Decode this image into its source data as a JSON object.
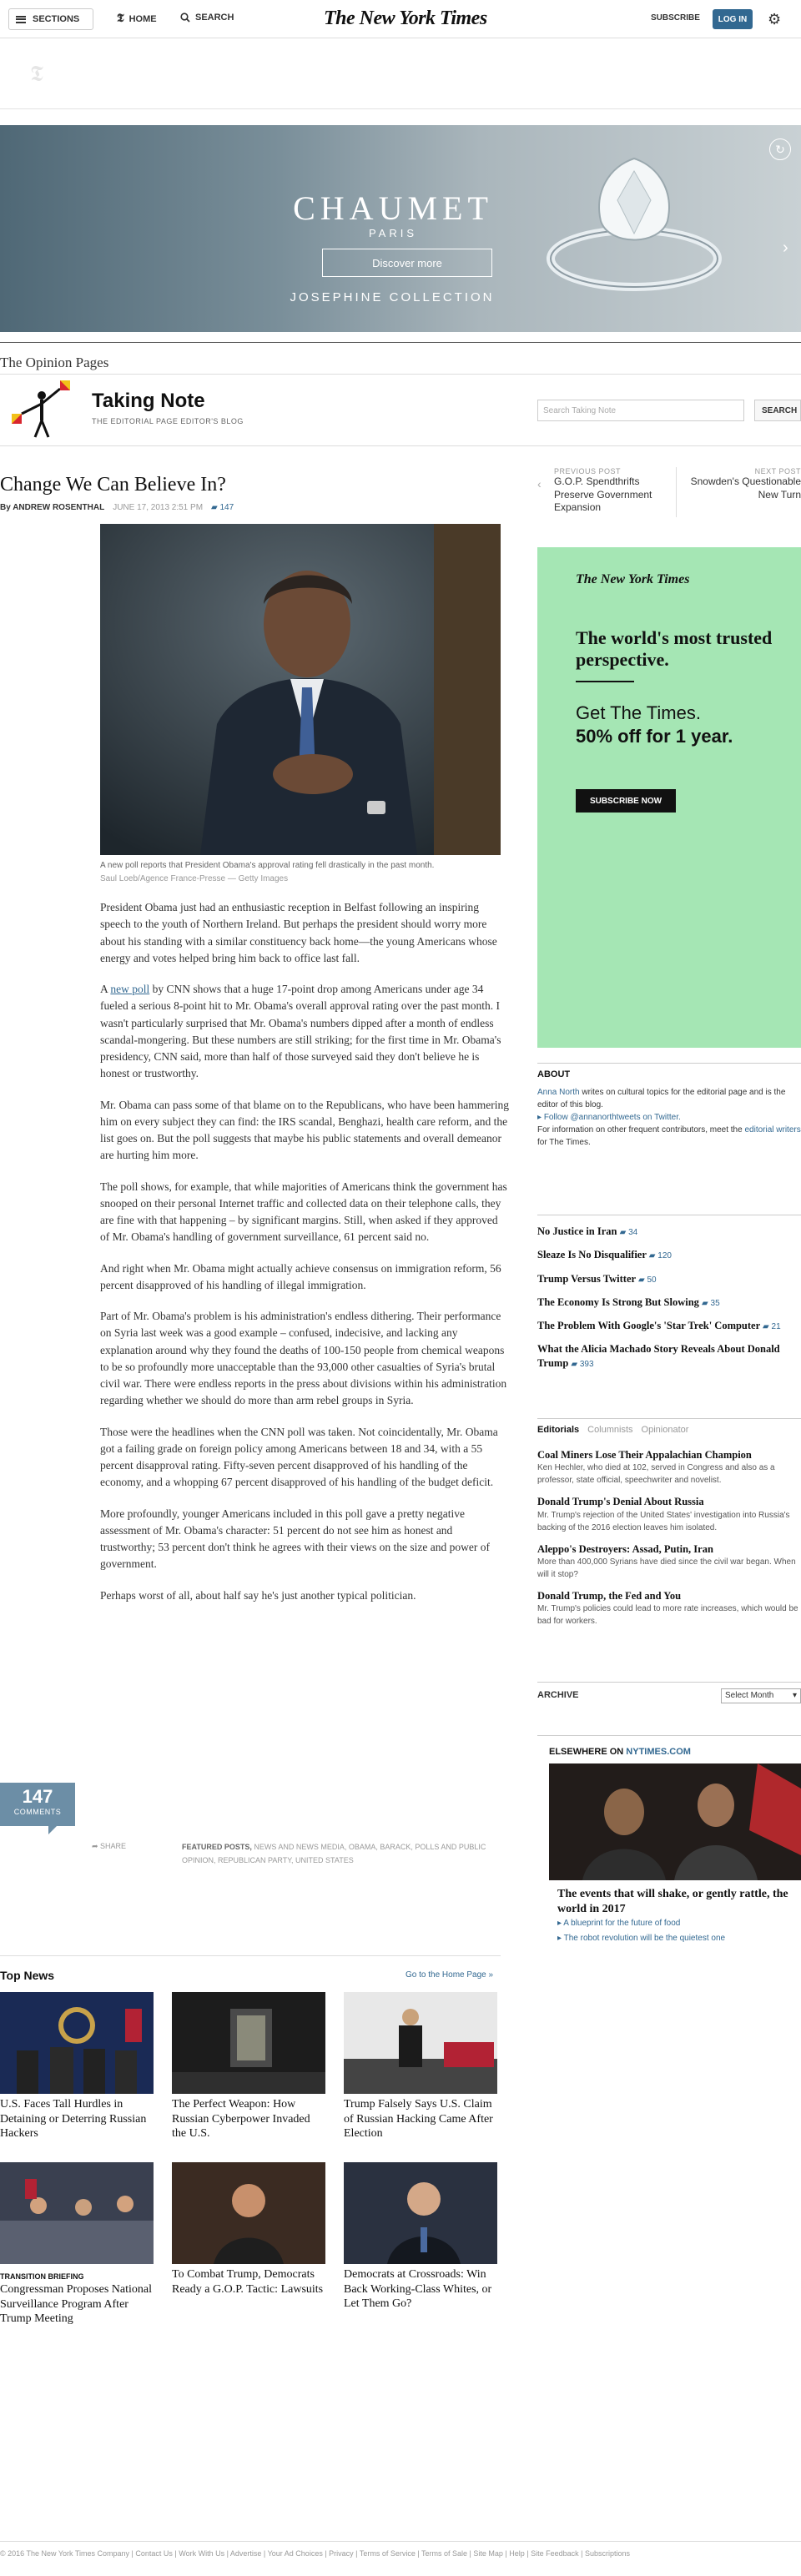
{
  "topbar": {
    "sections_label": "SECTIONS",
    "home_label": "HOME",
    "search_label": "SEARCH",
    "logo": "The New York Times",
    "subscribe_label": "SUBSCRIBE",
    "login_label": "LOG IN"
  },
  "ad": {
    "brand": "CHAUMET",
    "city": "PARIS",
    "cta": "Discover more",
    "collection": "JOSEPHINE COLLECTION"
  },
  "blog": {
    "section": "The Opinion Pages",
    "title": "Taking Note",
    "subtitle": "THE EDITORIAL PAGE EDITOR'S BLOG",
    "search_placeholder": "Search Taking Note",
    "search_button": "SEARCH"
  },
  "article": {
    "headline": "Change We Can Believe In?",
    "byline": "By ANDREW ROSENTHAL",
    "date": "JUNE 17, 2013 2:51 PM",
    "comment_count": "147",
    "caption": "A new poll reports that President Obama's approval rating fell drastically in the past month.",
    "credit": "Saul Loeb/Agence France-Presse — Getty Images",
    "p1": "President Obama just had an enthusiastic reception in Belfast following an inspiring speech to the youth of Northern Ireland. But perhaps the president should worry more about his standing with a similar constituency back home—the young Americans whose energy and votes helped bring him back to office last fall.",
    "p2_pre": "A ",
    "p2_link": "new poll",
    "p2_post": " by CNN shows that a huge 17-point drop among Americans under age 34 fueled a serious 8-point hit to Mr. Obama's overall approval rating over the past month. I wasn't particularly surprised that Mr. Obama's numbers dipped after a month of endless scandal-mongering. But these numbers are still striking; for the first time in Mr. Obama's presidency, CNN said, more than half of those surveyed said they don't believe he is honest or trustworthy.",
    "p3": "Mr. Obama can pass some of that blame on to the Republicans, who have been hammering him on every subject they can find: the IRS scandal, Benghazi, health care reform, and the list goes on. But the poll suggests that maybe his public statements and overall demeanor are hurting him more.",
    "p4": "The poll shows, for example, that while majorities of Americans think the government has snooped on their personal Internet traffic and collected data on their telephone calls, they are fine with that happening – by significant margins. Still, when asked if they approved of Mr. Obama's handling of government surveillance, 61 percent said no.",
    "p5": "And right when Mr. Obama might actually achieve consensus on immigration reform, 56 percent disapproved of his handling of illegal immigration.",
    "p6": "Part of Mr. Obama's problem is his administration's endless dithering. Their performance on Syria last week was a good example – confused, indecisive, and lacking any explanation around why they found the deaths of 100-150 people from chemical weapons to be so profoundly more unacceptable than the 93,000 other casualties of Syria's brutal civil war. There were endless reports in the press about divisions within his administration regarding whether we should do more than arm rebel groups in Syria.",
    "p7": "Those were the headlines when the CNN poll was taken. Not coincidentally, Mr. Obama got a failing grade on foreign policy among Americans between 18 and 34, with a 55 percent disapproval rating. Fifty-seven percent disapproved of his handling of the economy, and a whopping 67 percent disapproved of his handling of the budget deficit.",
    "p8": "More profoundly, younger Americans included in this poll gave a pretty negative assessment of Mr. Obama's character: 51 percent do not see him as honest and trustworthy; 53 percent don't think he agrees with their views on the size and power of government.",
    "p9": "Perhaps worst of all, about half say he's just another typical politician.",
    "comments_label": "COMMENTS",
    "share_label": "SHARE",
    "featured_label": "FEATURED POSTS,",
    "tags": "NEWS AND NEWS MEDIA, OBAMA, BARACK, POLLS AND PUBLIC OPINION, REPUBLICAN PARTY, UNITED STATES"
  },
  "postnav": {
    "prev_label": "PREVIOUS POST",
    "prev_title": "G.O.P. Spendthrifts Preserve Government Expansion",
    "next_label": "NEXT POST",
    "next_title": "Snowden's Questionable New Turn"
  },
  "ad2": {
    "logo": "The New York Times",
    "headline": "The world's most trusted perspective.",
    "line1": "Get The Times.",
    "line2": "50% off for 1 year.",
    "button": "SUBSCRIBE NOW"
  },
  "about": {
    "heading": "ABOUT",
    "author_link": "Anna North",
    "text1": " writes on cultural topics for the editorial page and is the editor of this blog.",
    "follow": "Follow @annanorthtweets on Twitter.",
    "text2": "For information on other frequent contributors, meet the ",
    "writers_link": "editorial writers",
    "text3": " for The Times."
  },
  "sidelist": [
    {
      "title": "No Justice in Iran",
      "count": "34"
    },
    {
      "title": "Sleaze Is No Disqualifier",
      "count": "120"
    },
    {
      "title": "Trump Versus Twitter",
      "count": "50"
    },
    {
      "title": "The Economy Is Strong But Slowing",
      "count": "35"
    },
    {
      "title": "The Problem With Google's 'Star Trek' Computer",
      "count": "21"
    },
    {
      "title": "What the Alicia Machado Story Reveals About Donald Trump",
      "count": "393"
    }
  ],
  "edtabs": {
    "a": "Editorials",
    "b": "Columnists",
    "c": "Opinionator"
  },
  "editorials": [
    {
      "title": "Coal Miners Lose Their Appalachian Champion",
      "desc": "Ken Hechler, who died at 102, served in Congress and also as a professor, state official, speechwriter and novelist."
    },
    {
      "title": "Donald Trump's Denial About Russia",
      "desc": "Mr. Trump's rejection of the United States' investigation into Russia's backing of the 2016 election leaves him isolated."
    },
    {
      "title": "Aleppo's Destroyers: Assad, Putin, Iran",
      "desc": "More than 400,000 Syrians have died since the civil war began. When will it stop?"
    },
    {
      "title": "Donald Trump, the Fed and You",
      "desc": "Mr. Trump's policies could lead to more rate increases, which would be bad for workers."
    }
  ],
  "archive": {
    "heading": "ARCHIVE",
    "select": "Select Month"
  },
  "elsewhere": {
    "label": "ELSEWHERE ON",
    "site": "NYTIMES.COM",
    "title": "The events that will shake, or gently rattle, the world in 2017",
    "link1": "A blueprint for the future of food",
    "link2": "The robot revolution will be the quietest one"
  },
  "topnews": {
    "heading": "Top News",
    "home_link": "Go to the Home Page »",
    "items": [
      {
        "kicker": "",
        "title": "U.S. Faces Tall Hurdles in Detaining or Deterring Russian Hackers"
      },
      {
        "kicker": "",
        "title": "The Perfect Weapon: How Russian Cyberpower Invaded the U.S."
      },
      {
        "kicker": "",
        "title": "Trump Falsely Says U.S. Claim of Russian Hacking Came After Election"
      },
      {
        "kicker": "TRANSITION BRIEFING",
        "title": "Congressman Proposes National Surveillance Program After Trump Meeting"
      },
      {
        "kicker": "",
        "title": "To Combat Trump, Democrats Ready a G.O.P. Tactic: Lawsuits"
      },
      {
        "kicker": "",
        "title": "Democrats at Crossroads: Win Back Working-Class Whites, or Let Them Go?"
      }
    ]
  },
  "footer": "© 2016 The New York Times Company | Contact Us | Work With Us | Advertise | Your Ad Choices | Privacy | Terms of Service | Terms of Sale | Site Map | Help | Site Feedback | Subscriptions"
}
